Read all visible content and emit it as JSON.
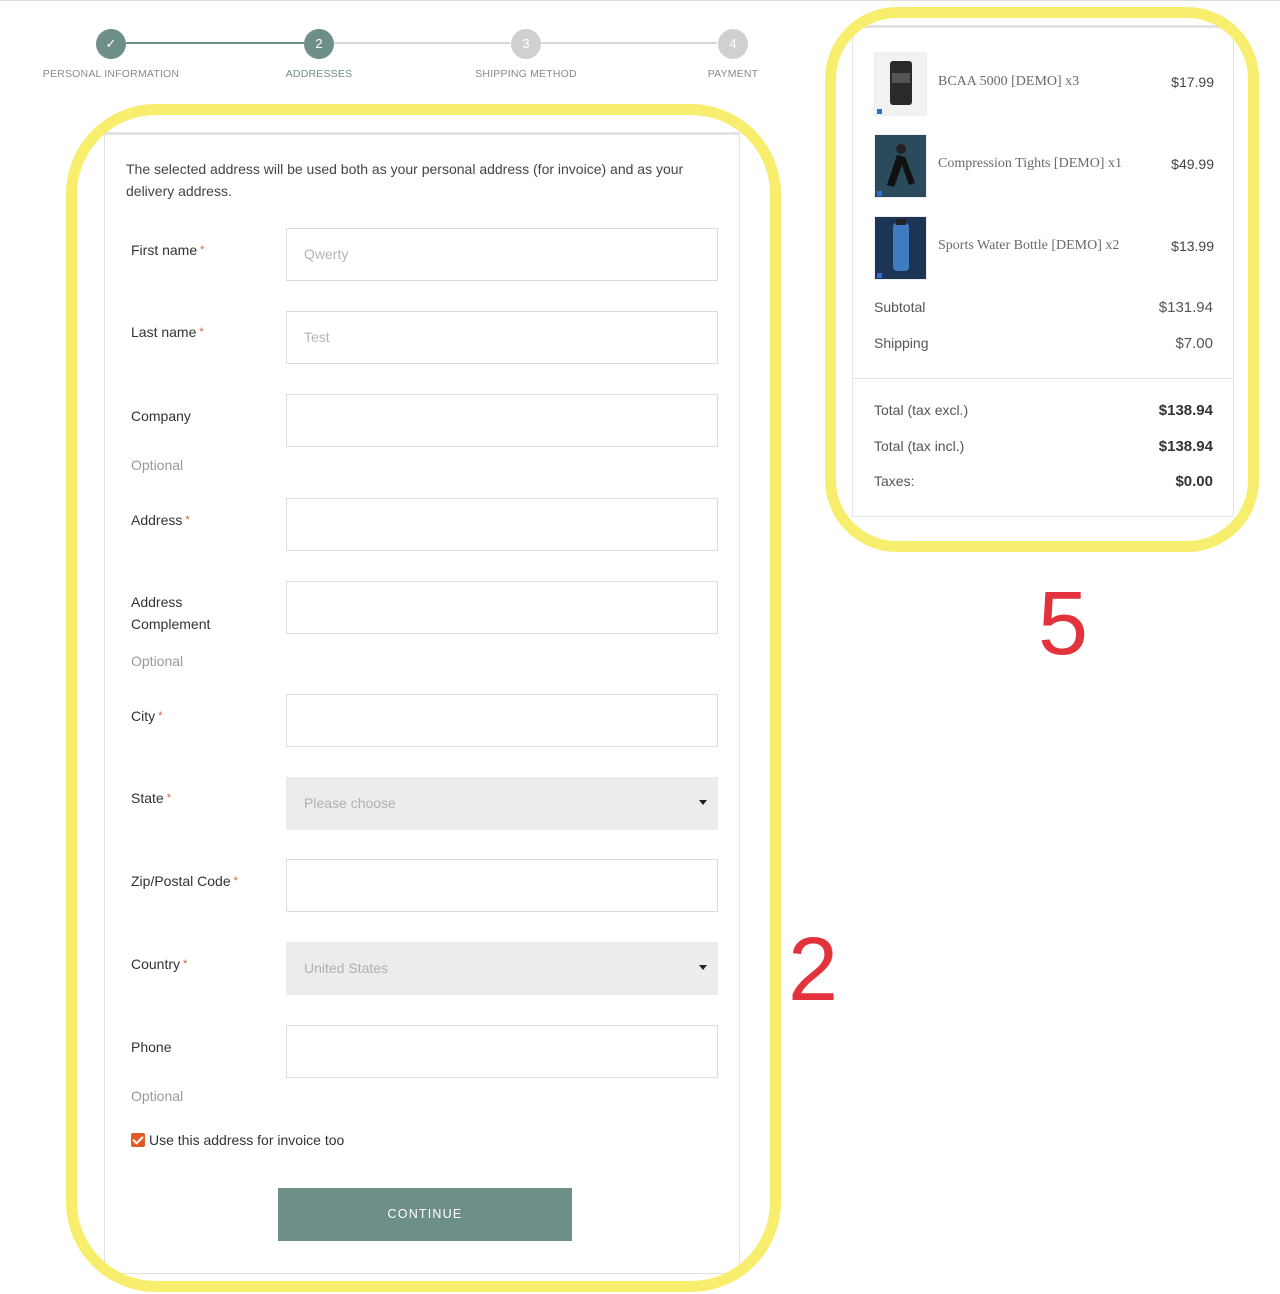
{
  "stepper": {
    "steps": [
      {
        "number": "1",
        "label": "PERSONAL INFORMATION",
        "state": "done",
        "icon": "check-icon"
      },
      {
        "number": "2",
        "label": "ADDRESSES",
        "state": "current"
      },
      {
        "number": "3",
        "label": "SHIPPING METHOD",
        "state": "todo"
      },
      {
        "number": "4",
        "label": "PAYMENT",
        "state": "todo"
      }
    ],
    "check_glyph": "✓"
  },
  "form": {
    "intro": "The selected address will be used both as your personal address (for invoice) and as your delivery address.",
    "required_mark": "*",
    "fields": {
      "first_name": {
        "label": "First name",
        "value": "Qwerty"
      },
      "last_name": {
        "label": "Last name",
        "value": "Test"
      },
      "company": {
        "label": "Company",
        "value": "",
        "hint": "Optional"
      },
      "address": {
        "label": "Address",
        "value": ""
      },
      "address_complement": {
        "label": "Address Complement",
        "value": "",
        "hint": "Optional"
      },
      "city": {
        "label": "City",
        "value": ""
      },
      "state": {
        "label": "State",
        "value": "Please choose"
      },
      "zip": {
        "label": "Zip/Postal Code",
        "value": ""
      },
      "country": {
        "label": "Country",
        "value": "United States"
      },
      "phone": {
        "label": "Phone",
        "value": "",
        "hint": "Optional"
      }
    },
    "invoice_checkbox": {
      "label": "Use this address for invoice too",
      "checked": true
    },
    "continue_label": "CONTINUE"
  },
  "cart": {
    "items": [
      {
        "name": "BCAA 5000 [DEMO] x3",
        "price": "$17.99",
        "thumb_color": "#2a2a2a"
      },
      {
        "name": "Compression Tights [DEMO] x1",
        "price": "$49.99",
        "thumb_color": "#2b4a5c"
      },
      {
        "name": "Sports Water Bottle [DEMO] x2",
        "price": "$13.99",
        "thumb_color": "#1c3557"
      }
    ],
    "subtotal_label": "Subtotal",
    "subtotal": "$131.94",
    "shipping_label": "Shipping",
    "shipping": "$7.00",
    "total_excl_label": "Total (tax excl.)",
    "total_excl": "$138.94",
    "total_incl_label": "Total (tax incl.)",
    "total_incl": "$138.94",
    "taxes_label": "Taxes:",
    "taxes": "$0.00"
  },
  "annotations": {
    "form_number": "2",
    "cart_number": "5",
    "outline_color": "#f7ee6e",
    "number_color": "#e2333c"
  },
  "colors": {
    "accent": "#6e8f88",
    "checkbox": "#e05a2a",
    "required": "#e05a3a"
  }
}
